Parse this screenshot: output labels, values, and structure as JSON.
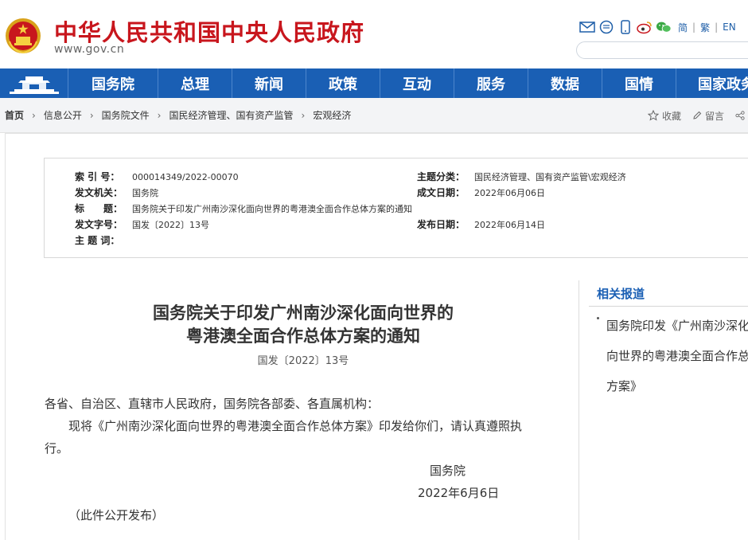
{
  "header": {
    "title": "中华人民共和国中央人民政府",
    "url": "www.gov.cn",
    "lang_simplified": "简",
    "lang_traditional": "繁",
    "lang_english": "EN",
    "icons": [
      "mail-icon",
      "chat-icon",
      "mobile-icon",
      "weibo-icon",
      "wechat-icon"
    ]
  },
  "nav": {
    "items": [
      "国务院",
      "总理",
      "新闻",
      "政策",
      "互动",
      "服务",
      "数据",
      "国情",
      "国家政务"
    ]
  },
  "breadcrumb": {
    "items": [
      "首页",
      "信息公开",
      "国务院文件",
      "国民经济管理、国有资产监管",
      "宏观经济"
    ],
    "favorite": "收藏",
    "comment": "留言"
  },
  "info": {
    "index_label": "索 引 号：",
    "index_value": "000014349/2022-00070",
    "topic_label": "主题分类：",
    "topic_value": "国民经济管理、国有资产监管\\宏观经济",
    "issuer_label": "发文机关：",
    "issuer_value": "国务院",
    "date_created_label": "成文日期：",
    "date_created_value": "2022年06月06日",
    "title_label": "标　　题：",
    "title_value": "国务院关于印发广州南沙深化面向世界的粤港澳全面合作总体方案的通知",
    "docno_label": "发文字号：",
    "docno_value": "国发〔2022〕13号",
    "pubdate_label": "发布日期：",
    "pubdate_value": "2022年06月14日",
    "keywords_label": "主 题 词："
  },
  "article": {
    "title_line1": "国务院关于印发广州南沙深化面向世界的",
    "title_line2": "粤港澳全面合作总体方案的通知",
    "doc_number": "国发〔2022〕13号",
    "salutation": "各省、自治区、直辖市人民政府，国务院各部委、各直属机构：",
    "body_line1": "现将《广州南沙深化面向世界的粤港澳全面合作总体方案》印发给你们，请认真遵照执",
    "body_line2": "行。",
    "signer": "国务院",
    "sign_date": "2022年6月6日",
    "note": "（此件公开发布）"
  },
  "sidebar": {
    "heading": "相关报道",
    "link_line1": "国务院印发《广州南沙深化面",
    "link_line2": "向世界的粤港澳全面合作总体",
    "link_line3": "方案》"
  },
  "colors": {
    "brand_red": "#c8161d",
    "nav_blue": "#1a5fb4"
  }
}
